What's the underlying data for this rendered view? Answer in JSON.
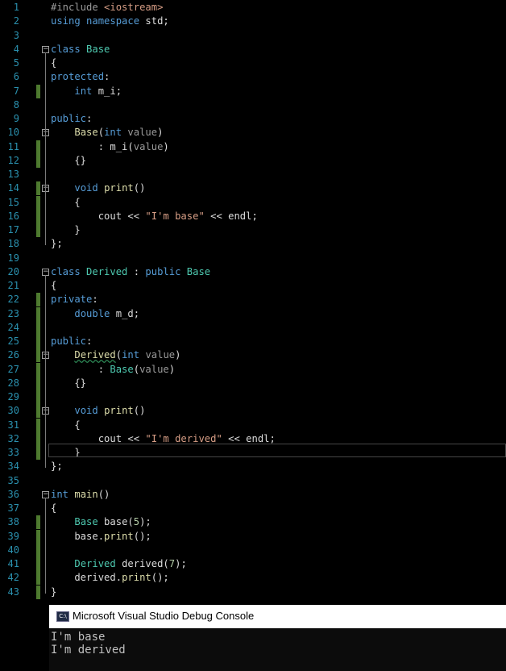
{
  "editor": {
    "lines": [
      {
        "n": "1",
        "html": "<span class=\"pp\">#include</span> <span class=\"st\">&lt;iostream&gt;</span>"
      },
      {
        "n": "2",
        "html": "<span class=\"kw\">using namespace</span> std;"
      },
      {
        "n": "3",
        "html": ""
      },
      {
        "n": "4",
        "html": "<span class=\"kw\">class</span> <span class=\"ty\">Base</span>"
      },
      {
        "n": "5",
        "html": "{"
      },
      {
        "n": "6",
        "html": "<span class=\"kw\">protected</span>:"
      },
      {
        "n": "7",
        "html": "    <span class=\"kw\">int</span> <span class=\"mb\">m_i</span>;"
      },
      {
        "n": "8",
        "html": ""
      },
      {
        "n": "9",
        "html": "<span class=\"kw\">public</span>:"
      },
      {
        "n": "10",
        "html": "    <span class=\"fn\">Base</span>(<span class=\"kw\">int</span> <span class=\"pa\">value</span>)"
      },
      {
        "n": "11",
        "html": "        : <span class=\"mb\">m_i</span>(<span class=\"pa\">value</span>)"
      },
      {
        "n": "12",
        "html": "    {}"
      },
      {
        "n": "13",
        "html": ""
      },
      {
        "n": "14",
        "html": "    <span class=\"kw\">void</span> <span class=\"fn\">print</span>()"
      },
      {
        "n": "15",
        "html": "    {"
      },
      {
        "n": "16",
        "html": "        cout &lt;&lt; <span class=\"st\">\"I'm base\"</span> &lt;&lt; endl;"
      },
      {
        "n": "17",
        "html": "    }"
      },
      {
        "n": "18",
        "html": "};"
      },
      {
        "n": "19",
        "html": ""
      },
      {
        "n": "20",
        "html": "<span class=\"kw\">class</span> <span class=\"ty\">Derived</span> : <span class=\"kw\">public</span> <span class=\"ty\">Base</span>"
      },
      {
        "n": "21",
        "html": "{"
      },
      {
        "n": "22",
        "html": "<span class=\"kw\">private</span>:"
      },
      {
        "n": "23",
        "html": "    <span class=\"kw\">double</span> <span class=\"mb\">m_d</span>;"
      },
      {
        "n": "24",
        "html": ""
      },
      {
        "n": "25",
        "html": "<span class=\"kw\">public</span>:"
      },
      {
        "n": "26",
        "html": "    <span class=\"fn sq\">Derived</span>(<span class=\"kw\">int</span> <span class=\"pa\">value</span>)"
      },
      {
        "n": "27",
        "html": "        : <span class=\"ty\">Base</span>(<span class=\"pa\">value</span>)"
      },
      {
        "n": "28",
        "html": "    {}"
      },
      {
        "n": "29",
        "html": ""
      },
      {
        "n": "30",
        "html": "    <span class=\"kw\">void</span> <span class=\"fn\">print</span>()"
      },
      {
        "n": "31",
        "html": "    {"
      },
      {
        "n": "32",
        "html": "        cout &lt;&lt; <span class=\"st\">\"I'm derived\"</span> &lt;&lt; endl;"
      },
      {
        "n": "33",
        "html": "    }"
      },
      {
        "n": "34",
        "html": "};"
      },
      {
        "n": "35",
        "html": ""
      },
      {
        "n": "36",
        "html": "<span class=\"kw\">int</span> <span class=\"fn\">main</span>()"
      },
      {
        "n": "37",
        "html": "{"
      },
      {
        "n": "38",
        "html": "    <span class=\"ty\">Base</span> base(<span class=\"nm\">5</span>);"
      },
      {
        "n": "39",
        "html": "    base.<span class=\"fn\">print</span>();"
      },
      {
        "n": "40",
        "html": ""
      },
      {
        "n": "41",
        "html": "    <span class=\"ty\">Derived</span> derived(<span class=\"nm\">7</span>);"
      },
      {
        "n": "42",
        "html": "    derived.<span class=\"fn\">print</span>();"
      },
      {
        "n": "43",
        "html": "}"
      }
    ],
    "changed_lines": [
      "7",
      "11",
      "12",
      "14",
      "15",
      "16",
      "17",
      "22",
      "23",
      "24",
      "25",
      "26",
      "27",
      "28",
      "29",
      "30",
      "31",
      "32",
      "33",
      "38",
      "39",
      "40",
      "41",
      "42",
      "43"
    ],
    "fold_lines": [
      "4",
      "10",
      "14",
      "20",
      "26",
      "30",
      "36"
    ],
    "colors": {
      "keyword": "#569cd6",
      "type": "#4ec9b0",
      "function": "#dcdcaa",
      "string": "#d69d85",
      "line_number": "#2b91af",
      "change_bar": "#4e7a2f"
    }
  },
  "console": {
    "title": "Microsoft Visual Studio Debug Console",
    "icon": "console-app-icon",
    "output": [
      "I'm base",
      "I'm derived"
    ]
  }
}
